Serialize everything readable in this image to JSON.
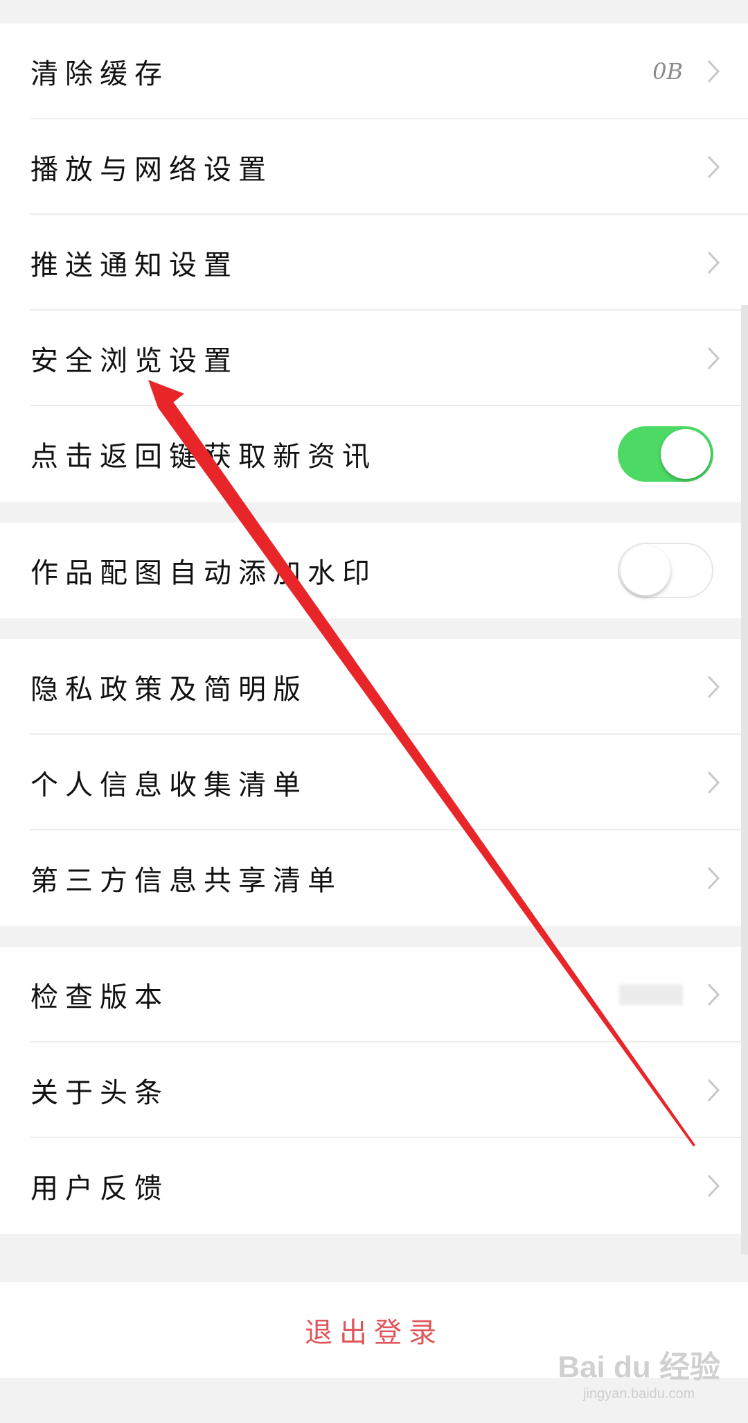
{
  "settings": {
    "group1": [
      {
        "label": "清除缓存",
        "value": "0B"
      },
      {
        "label": "播放与网络设置"
      },
      {
        "label": "推送通知设置"
      },
      {
        "label": "安全浏览设置"
      },
      {
        "label": "点击返回键获取新资讯",
        "toggle": "on"
      }
    ],
    "group2": [
      {
        "label": "作品配图自动添加水印",
        "toggle": "off"
      }
    ],
    "group3": [
      {
        "label": "隐私政策及简明版"
      },
      {
        "label": "个人信息收集清单"
      },
      {
        "label": "第三方信息共享清单"
      }
    ],
    "group4": [
      {
        "label": "检查版本"
      },
      {
        "label": "关于头条"
      },
      {
        "label": "用户反馈"
      }
    ]
  },
  "logout": {
    "label": "退出登录"
  },
  "watermark": {
    "main": "Bai du 经验",
    "sub": "jingyan.baidu.com"
  },
  "colors": {
    "toggle_on": "#4cd964",
    "logout_text": "#e0555a",
    "annotation_arrow": "#e8262a"
  }
}
